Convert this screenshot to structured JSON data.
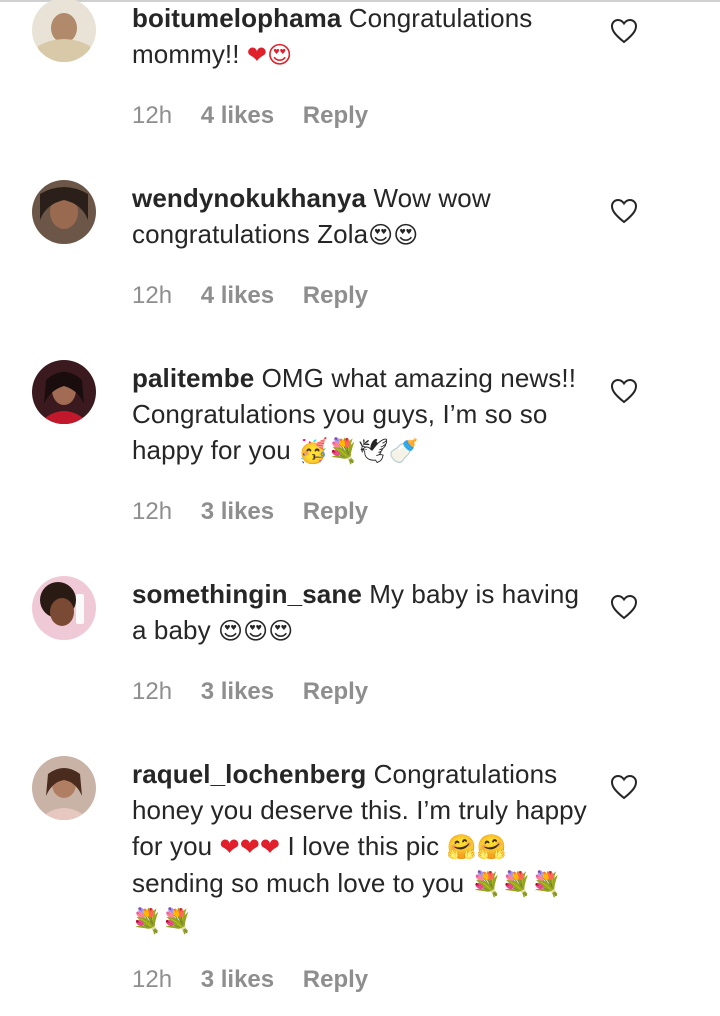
{
  "comments": [
    {
      "username": "boitumelophama",
      "text": "Congratulations mommy!!",
      "emojis": "❤😍",
      "time": "12h",
      "likes": "4 likes",
      "reply": "Reply"
    },
    {
      "username": "wendynokukhanya",
      "text": "Wow wow congratulations Zola",
      "emojis": "😍😍",
      "time": "12h",
      "likes": "4 likes",
      "reply": "Reply"
    },
    {
      "username": "palitembe",
      "text": "OMG what amazing news!! Congratulations you guys, I’m so so happy for you",
      "emojis": "🥳💐🕊🍼",
      "time": "12h",
      "likes": "3 likes",
      "reply": "Reply"
    },
    {
      "username": "somethingin_sane",
      "text": "My baby is having a baby",
      "emojis": "😍😍😍",
      "time": "12h",
      "likes": "3 likes",
      "reply": "Reply"
    },
    {
      "username": "raquel_lochenberg",
      "text_a": "Congratulations honey you deserve this. I’m truly happy for you",
      "emojis_a": "❤❤❤",
      "text_b": "I love this pic",
      "emojis_b": "🤗🤗",
      "text_c": "sending so much love to you",
      "emojis_c": "💐💐💐💐💐",
      "time": "12h",
      "likes": "3 likes",
      "reply": "Reply"
    }
  ],
  "icons": {
    "like": "heart-outline-icon"
  },
  "colors": {
    "text": "#262626",
    "meta": "#8e8e8e",
    "heart": "#e0202a"
  }
}
